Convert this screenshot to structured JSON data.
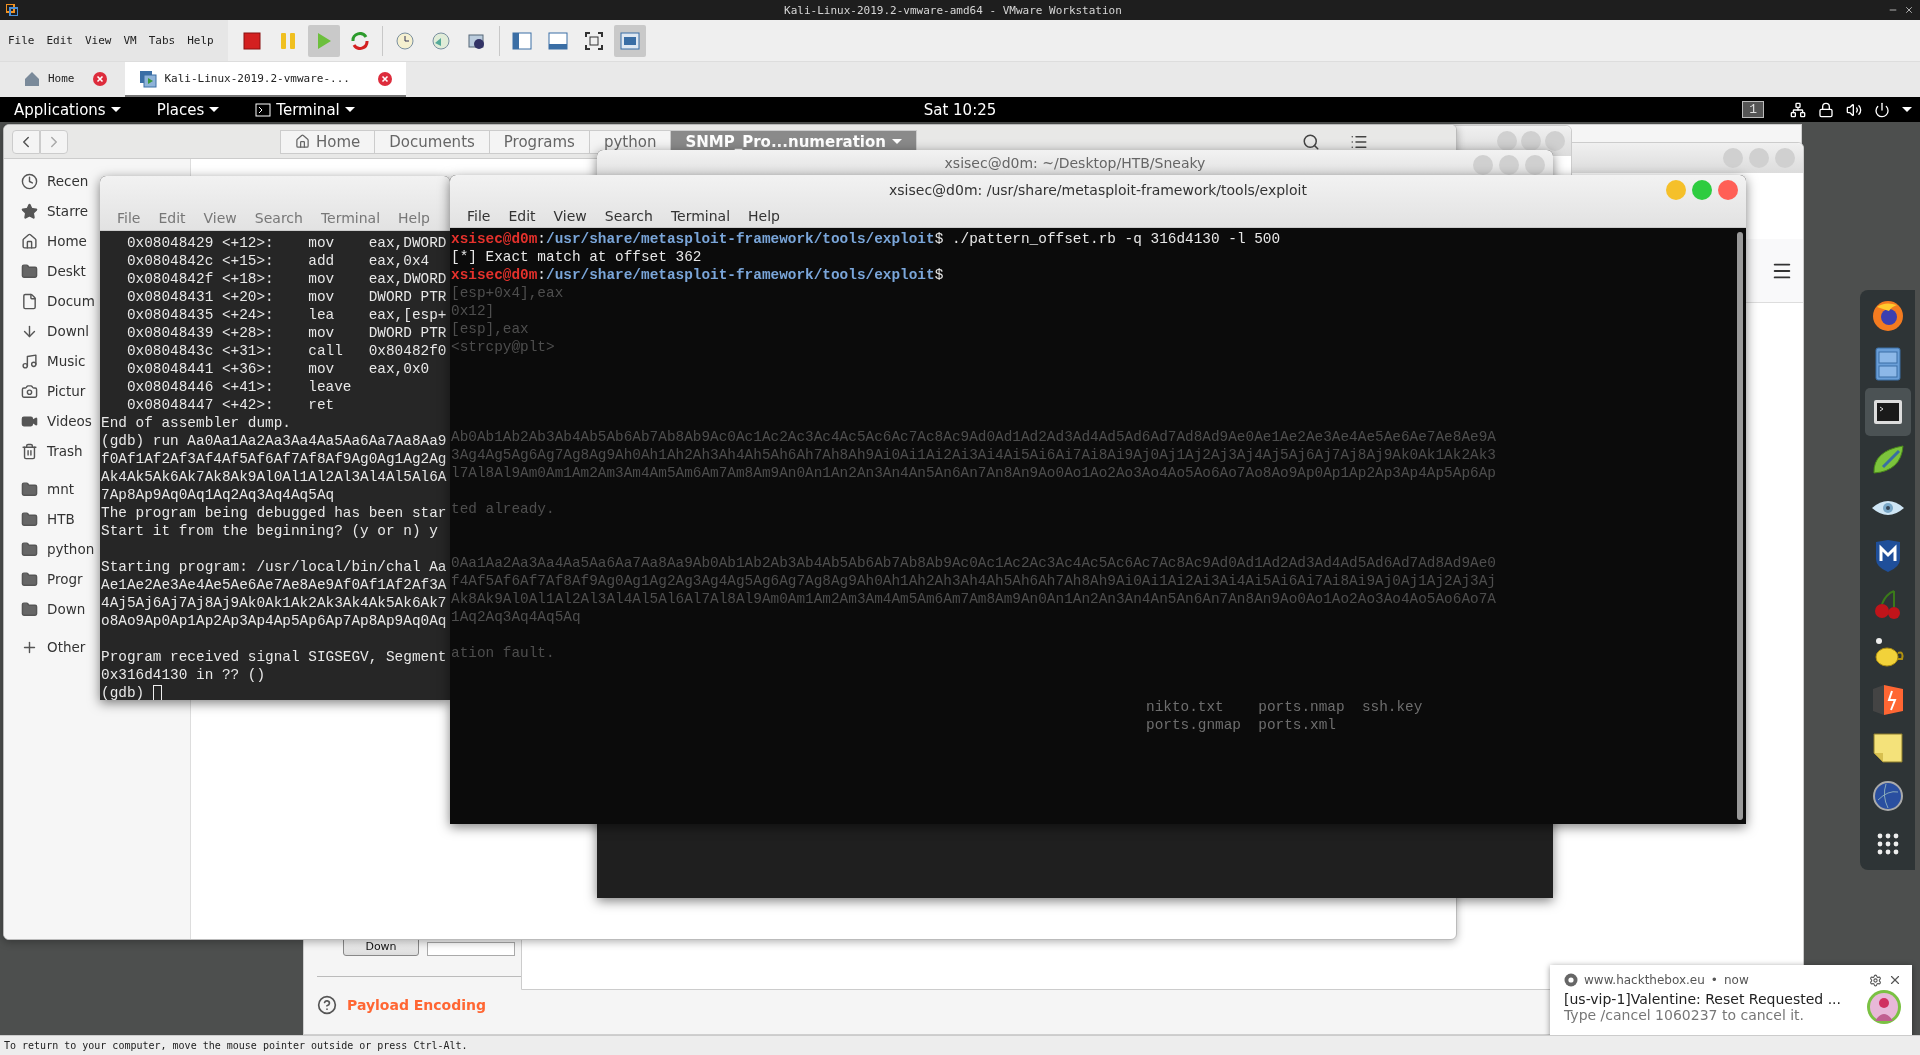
{
  "vmware": {
    "title": "Kali-Linux-2019.2-vmware-amd64 - VMware Workstation",
    "menu": [
      "File",
      "Edit",
      "View",
      "VM",
      "Tabs",
      "Help"
    ],
    "toolbar": [
      {
        "kind": "stop",
        "selected": false
      },
      {
        "kind": "pause",
        "selected": false
      },
      {
        "kind": "play",
        "selected": true
      },
      {
        "kind": "restart",
        "selected": false
      },
      {
        "kind": "snapshot",
        "selected": false,
        "separator_before": true
      },
      {
        "kind": "revert",
        "selected": false
      },
      {
        "kind": "snapshots",
        "selected": false
      },
      {
        "kind": "library",
        "selected": false,
        "separator_before": true
      },
      {
        "kind": "thumbnails",
        "selected": false
      },
      {
        "kind": "fullscreen",
        "selected": false
      },
      {
        "kind": "console",
        "selected": true
      }
    ],
    "tabs": [
      {
        "label": "Home",
        "kind": "home",
        "selected": false
      },
      {
        "label": "Kali-Linux-2019.2-vmware-...",
        "kind": "vm",
        "selected": true
      }
    ],
    "status_bar": "To return to your computer, move the mouse pointer outside or press Ctrl-Alt."
  },
  "top_bar": {
    "menus": [
      {
        "label": "Applications",
        "kind": "plain"
      },
      {
        "label": "Places",
        "kind": "plain"
      },
      {
        "label": "Terminal",
        "kind": "terminal"
      }
    ],
    "clock": "Sat 10:25",
    "workspace": "1"
  },
  "file_manager": {
    "path": [
      {
        "label": "Home",
        "kind": "home",
        "selected": false
      },
      {
        "label": "Documents",
        "kind": "plain",
        "selected": false
      },
      {
        "label": "Programs",
        "kind": "plain",
        "selected": false
      },
      {
        "label": "python",
        "kind": "plain",
        "selected": false
      },
      {
        "label": "SNMP_Pro...numeration",
        "kind": "plain",
        "selected": true
      }
    ],
    "sidebar": [
      {
        "label": "Recen",
        "kind": "recent"
      },
      {
        "label": "Starre",
        "kind": "starred"
      },
      {
        "label": "Home",
        "kind": "home"
      },
      {
        "label": "Deskt",
        "kind": "folder"
      },
      {
        "label": "Docum",
        "kind": "document"
      },
      {
        "label": "Downl",
        "kind": "download"
      },
      {
        "label": "Music",
        "kind": "music"
      },
      {
        "label": "Pictur",
        "kind": "pictures"
      },
      {
        "label": "Videos",
        "kind": "videos"
      },
      {
        "label": "Trash",
        "kind": "trash"
      },
      {
        "label": "mnt",
        "kind": "folder",
        "separator_before": true
      },
      {
        "label": "HTB",
        "kind": "folder"
      },
      {
        "label": "python",
        "kind": "folder"
      },
      {
        "label": "Progr",
        "kind": "folder"
      },
      {
        "label": "Down",
        "kind": "folder"
      },
      {
        "label": "Other",
        "kind": "other",
        "separator_before": true
      }
    ]
  },
  "burp_panel": {
    "button": "Down",
    "section": "Payload Encoding"
  },
  "gdb_terminal": {
    "menu": [
      "File",
      "Edit",
      "View",
      "Search",
      "Terminal",
      "Help"
    ],
    "lines": [
      {
        "kind": "output",
        "text": "   0x08048429 <+12>:    mov    eax,DWORD"
      },
      {
        "kind": "output",
        "text": "   0x0804842c <+15>:    add    eax,0x4"
      },
      {
        "kind": "output",
        "text": "   0x0804842f <+18>:    mov    eax,DWORD"
      },
      {
        "kind": "output",
        "text": "   0x08048431 <+20>:    mov    DWORD PTR"
      },
      {
        "kind": "output",
        "text": "   0x08048435 <+24>:    lea    eax,[esp+"
      },
      {
        "kind": "output",
        "text": "   0x08048439 <+28>:    mov    DWORD PTR"
      },
      {
        "kind": "output",
        "text": "   0x0804843c <+31>:    call   0x80482f0"
      },
      {
        "kind": "output",
        "text": "   0x08048441 <+36>:    mov    eax,0x0"
      },
      {
        "kind": "output",
        "text": "   0x08048446 <+41>:    leave"
      },
      {
        "kind": "output",
        "text": "   0x08048447 <+42>:    ret"
      },
      {
        "kind": "output",
        "text": "End of assembler dump."
      },
      {
        "kind": "output",
        "text": "(gdb) run Aa0Aa1Aa2Aa3Aa4Aa5Aa6Aa7Aa8Aa9"
      },
      {
        "kind": "output",
        "text": "f0Af1Af2Af3Af4Af5Af6Af7Af8Af9Ag0Ag1Ag2Ag"
      },
      {
        "kind": "output",
        "text": "Ak4Ak5Ak6Ak7Ak8Ak9Al0Al1Al2Al3Al4Al5Al6A"
      },
      {
        "kind": "output",
        "text": "7Ap8Ap9Aq0Aq1Aq2Aq3Aq4Aq5Aq"
      },
      {
        "kind": "output",
        "text": "The program being debugged has been star"
      },
      {
        "kind": "output",
        "text": "Start it from the beginning? (y or n) y"
      },
      {
        "kind": "blank"
      },
      {
        "kind": "output",
        "text": "Starting program: /usr/local/bin/chal Aa"
      },
      {
        "kind": "output",
        "text": "Ae1Ae2Ae3Ae4Ae5Ae6Ae7Ae8Ae9Af0Af1Af2Af3A"
      },
      {
        "kind": "output",
        "text": "4Aj5Aj6Aj7Aj8Aj9Ak0Ak1Ak2Ak3Ak4Ak5Ak6Ak7"
      },
      {
        "kind": "output",
        "text": "o8Ao9Ap0Ap1Ap2Ap3Ap4Ap5Ap6Ap7Ap8Ap9Aq0Aq"
      },
      {
        "kind": "blank"
      },
      {
        "kind": "output",
        "text": "Program received signal SIGSEGV, Segment"
      },
      {
        "kind": "output",
        "text": "0x316d4130 in ?? ()"
      },
      {
        "kind": "input",
        "text": "(gdb)"
      }
    ]
  },
  "sneaky_terminal": {
    "title": "xsisec@d0m: ~/Desktop/HTB/Sneaky"
  },
  "exploit_terminal": {
    "title": "xsisec@d0m: /usr/share/metasploit-framework/tools/exploit",
    "menu": [
      "File",
      "Edit",
      "View",
      "Search",
      "Terminal",
      "Help"
    ],
    "lines": [
      {
        "kind": "prompt",
        "user": "xsisec@d0m",
        "colon": ":",
        "path": "/usr/share/metasploit-framework/tools/exploit",
        "sign": "$",
        "command": "./pattern_offset.rb -q 316d4130 -l 500"
      },
      {
        "kind": "output",
        "text": "[*] Exact match at offset 362"
      },
      {
        "kind": "prompt",
        "user": "xsisec@d0m",
        "colon": ":",
        "path": "/usr/share/metasploit-framework/tools/exploit",
        "sign": "$"
      },
      {
        "kind": "faint",
        "text": "[esp+0x4],eax"
      },
      {
        "kind": "faint",
        "text": "0x12]"
      },
      {
        "kind": "faint",
        "text": "[esp],eax"
      },
      {
        "kind": "faint",
        "text": "<strcpy@plt>"
      },
      {
        "kind": "blank"
      },
      {
        "kind": "blank"
      },
      {
        "kind": "blank"
      },
      {
        "kind": "blank"
      },
      {
        "kind": "faint",
        "text": "Ab0Ab1Ab2Ab3Ab4Ab5Ab6Ab7Ab8Ab9Ac0Ac1Ac2Ac3Ac4Ac5Ac6Ac7Ac8Ac9Ad0Ad1Ad2Ad3Ad4Ad5Ad6Ad7Ad8Ad9Ae0Ae1Ae2Ae3Ae4Ae5Ae6Ae7Ae8Ae9A"
      },
      {
        "kind": "faint",
        "text": "3Ag4Ag5Ag6Ag7Ag8Ag9Ah0Ah1Ah2Ah3Ah4Ah5Ah6Ah7Ah8Ah9Ai0Ai1Ai2Ai3Ai4Ai5Ai6Ai7Ai8Ai9Aj0Aj1Aj2Aj3Aj4Aj5Aj6Aj7Aj8Aj9Ak0Ak1Ak2Ak3"
      },
      {
        "kind": "faint",
        "text": "l7Al8Al9Am0Am1Am2Am3Am4Am5Am6Am7Am8Am9An0An1An2An3An4An5An6An7An8An9Ao0Ao1Ao2Ao3Ao4Ao5Ao6Ao7Ao8Ao9Ap0Ap1Ap2Ap3Ap4Ap5Ap6Ap"
      },
      {
        "kind": "blank"
      },
      {
        "kind": "faint",
        "text": "ted already."
      },
      {
        "kind": "blank"
      },
      {
        "kind": "blank"
      },
      {
        "kind": "faint",
        "text": "0Aa1Aa2Aa3Aa4Aa5Aa6Aa7Aa8Aa9Ab0Ab1Ab2Ab3Ab4Ab5Ab6Ab7Ab8Ab9Ac0Ac1Ac2Ac3Ac4Ac5Ac6Ac7Ac8Ac9Ad0Ad1Ad2Ad3Ad4Ad5Ad6Ad7Ad8Ad9Ae0"
      },
      {
        "kind": "faint",
        "text": "f4Af5Af6Af7Af8Af9Ag0Ag1Ag2Ag3Ag4Ag5Ag6Ag7Ag8Ag9Ah0Ah1Ah2Ah3Ah4Ah5Ah6Ah7Ah8Ah9Ai0Ai1Ai2Ai3Ai4Ai5Ai6Ai7Ai8Ai9Aj0Aj1Aj2Aj3Aj"
      },
      {
        "kind": "faint",
        "text": "Ak8Ak9Al0Al1Al2Al3Al4Al5Al6Al7Al8Al9Am0Am1Am2Am3Am4Am5Am6Am7Am8Am9An0An1An2An3An4An5An6An7An8An9Ao0Ao1Ao2Ao3Ao4Ao5Ao6Ao7A"
      },
      {
        "kind": "faint",
        "text": "1Aq2Aq3Aq4Aq5Aq"
      },
      {
        "kind": "blank"
      },
      {
        "kind": "faint",
        "text": "ation fault."
      },
      {
        "kind": "blank"
      },
      {
        "kind": "blank"
      },
      {
        "kind": "faint_right",
        "text": "nikto.txt    ports.nmap  ssh.key"
      },
      {
        "kind": "faint_right",
        "text": "ports.gnmap  ports.xml"
      }
    ]
  },
  "dock": [
    {
      "kind": "firefox",
      "selected": false
    },
    {
      "kind": "files",
      "selected": false
    },
    {
      "kind": "terminal",
      "selected": true
    },
    {
      "kind": "editor",
      "selected": false
    },
    {
      "kind": "eye",
      "selected": false
    },
    {
      "kind": "shield",
      "selected": false
    },
    {
      "kind": "cherry",
      "selected": false
    },
    {
      "kind": "teapot",
      "selected": false
    },
    {
      "kind": "burp",
      "selected": false
    },
    {
      "kind": "note",
      "selected": false
    },
    {
      "kind": "globe",
      "selected": false
    },
    {
      "kind": "apps",
      "selected": false
    }
  ],
  "notification": {
    "source": "www.hackthebox.eu",
    "separator": "•",
    "time": "now",
    "title": "[us-vip-1]Valentine: Reset Requested ...",
    "body": "Type /cancel 1060237 to cancel it."
  }
}
